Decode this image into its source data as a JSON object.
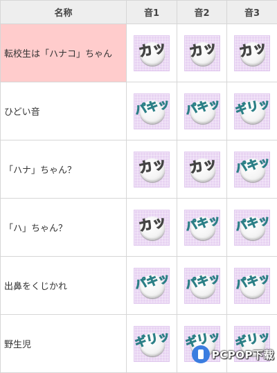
{
  "table": {
    "headers": [
      "名称",
      "音1",
      "音2",
      "音3"
    ],
    "rows": [
      {
        "name": "転校生は「ハナコ」ちゃん",
        "sounds": [
          {
            "icon": "kacchu-sound-icon",
            "text": "カッ"
          },
          {
            "icon": "kacchu-sound-icon",
            "text": "カッ"
          },
          {
            "icon": "kacchu-sound-icon",
            "text": "カッ"
          }
        ]
      },
      {
        "name": "ひどい音",
        "sounds": [
          {
            "icon": "paki-sound-icon",
            "text": "パキッ"
          },
          {
            "icon": "paki-sound-icon",
            "text": "パキッ"
          },
          {
            "icon": "giri-sound-icon",
            "text": "ギリッ"
          }
        ]
      },
      {
        "name": "「ハナ」ちゃん？",
        "sounds": [
          {
            "icon": "kacchu-sound-icon",
            "text": "カッ"
          },
          {
            "icon": "kacchu-sound-icon",
            "text": "カッ"
          },
          {
            "icon": "paki-sound-icon",
            "text": "パキッ"
          }
        ]
      },
      {
        "name": "「ハ」ちゃん？",
        "sounds": [
          {
            "icon": "kacchu-sound-icon",
            "text": "カッ"
          },
          {
            "icon": "paki-sound-icon",
            "text": "パキッ"
          },
          {
            "icon": "paki-sound-icon",
            "text": "パキッ"
          }
        ]
      },
      {
        "name": "出鼻をくじかれ",
        "sounds": [
          {
            "icon": "paki-sound-icon",
            "text": "パキッ"
          },
          {
            "icon": "paki-sound-icon",
            "text": "パキッ"
          },
          {
            "icon": "paki-sound-icon",
            "text": "パキッ"
          }
        ]
      },
      {
        "name": "野生児",
        "sounds": [
          {
            "icon": "giri-sound-icon",
            "text": "ギリッ"
          },
          {
            "icon": "giri-sound-icon",
            "text": "ギリッ"
          },
          {
            "icon": "giri-sound-icon",
            "text": "ギリッ"
          }
        ]
      }
    ]
  },
  "colors": {
    "highlight_row": "#ffcccc",
    "tile_bg": "#e8d3f2",
    "header_bg": "#eeeeee"
  },
  "watermark": {
    "text": "PCPOP下载"
  }
}
